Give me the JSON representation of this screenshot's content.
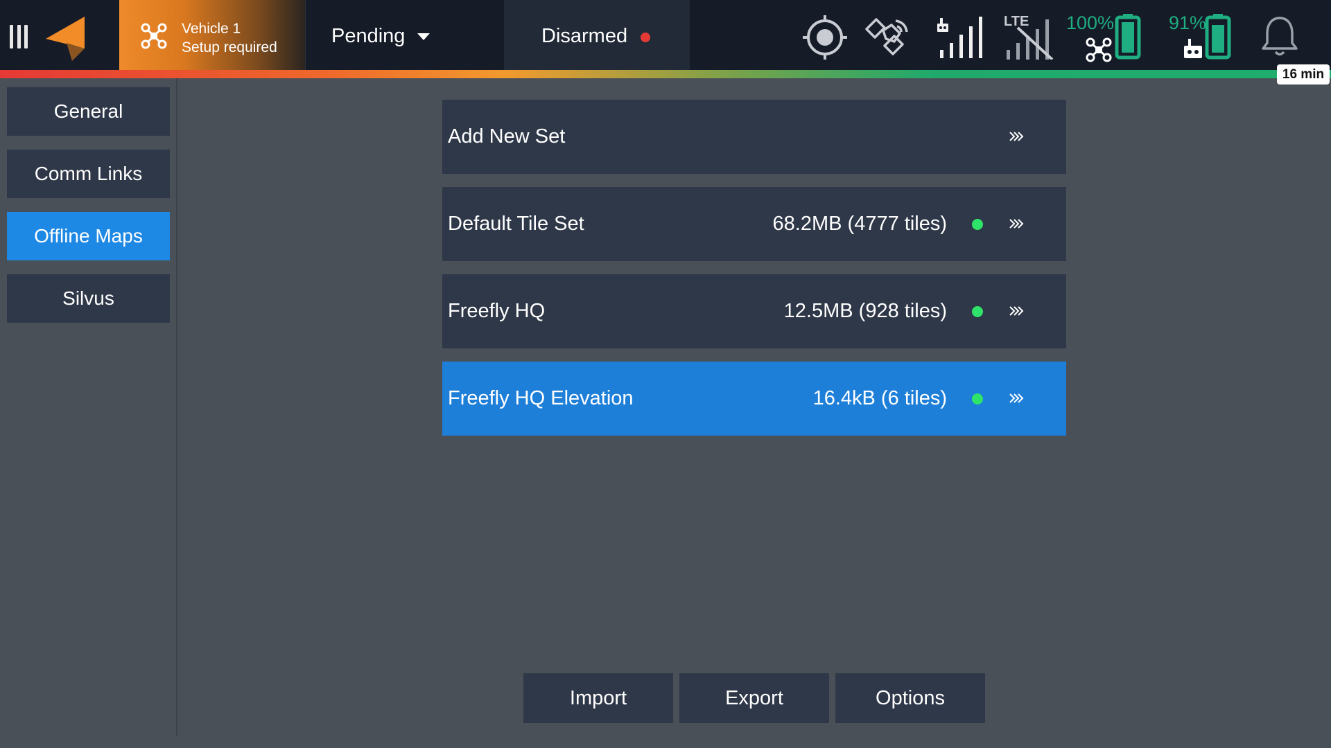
{
  "topbar": {
    "vehicle": {
      "name": "Vehicle 1",
      "status": "Setup required"
    },
    "flight_mode": "Pending",
    "arm_state": "Disarmed",
    "lte_label": "LTE",
    "vehicle_battery": "100%",
    "controller_battery": "91%",
    "flight_time": "16 min",
    "icons": [
      "menu-icon",
      "app-logo",
      "drone-icon",
      "caret-down-icon",
      "armed-status-dot",
      "gps-target-icon",
      "satellite-icon",
      "rc-signal-icon",
      "lte-signal-icon",
      "drone-battery-icon",
      "controller-battery-icon",
      "bell-icon",
      "chevron-right-double-icon"
    ],
    "colors": {
      "brand_orange": "#ee8a2a",
      "accent_blue": "#1e88e5",
      "battery_green": "#1fae82",
      "status_dot_green": "#2ee36a",
      "disarmed_red": "#e53935"
    }
  },
  "sidebar": {
    "items": [
      {
        "label": "General"
      },
      {
        "label": "Comm Links"
      },
      {
        "label": "Offline Maps"
      },
      {
        "label": "Silvus"
      }
    ],
    "active_index": 2
  },
  "tile_sets": {
    "add_new": "Add New Set",
    "sets": [
      {
        "name": "Default Tile Set",
        "size": "68.2MB (4777 tiles)"
      },
      {
        "name": "Freefly HQ",
        "size": "12.5MB (928 tiles)"
      },
      {
        "name": "Freefly HQ Elevation",
        "size": "16.4kB (6 tiles)"
      }
    ],
    "selected_index": 2
  },
  "actions": {
    "import": "Import",
    "export": "Export",
    "options": "Options"
  }
}
